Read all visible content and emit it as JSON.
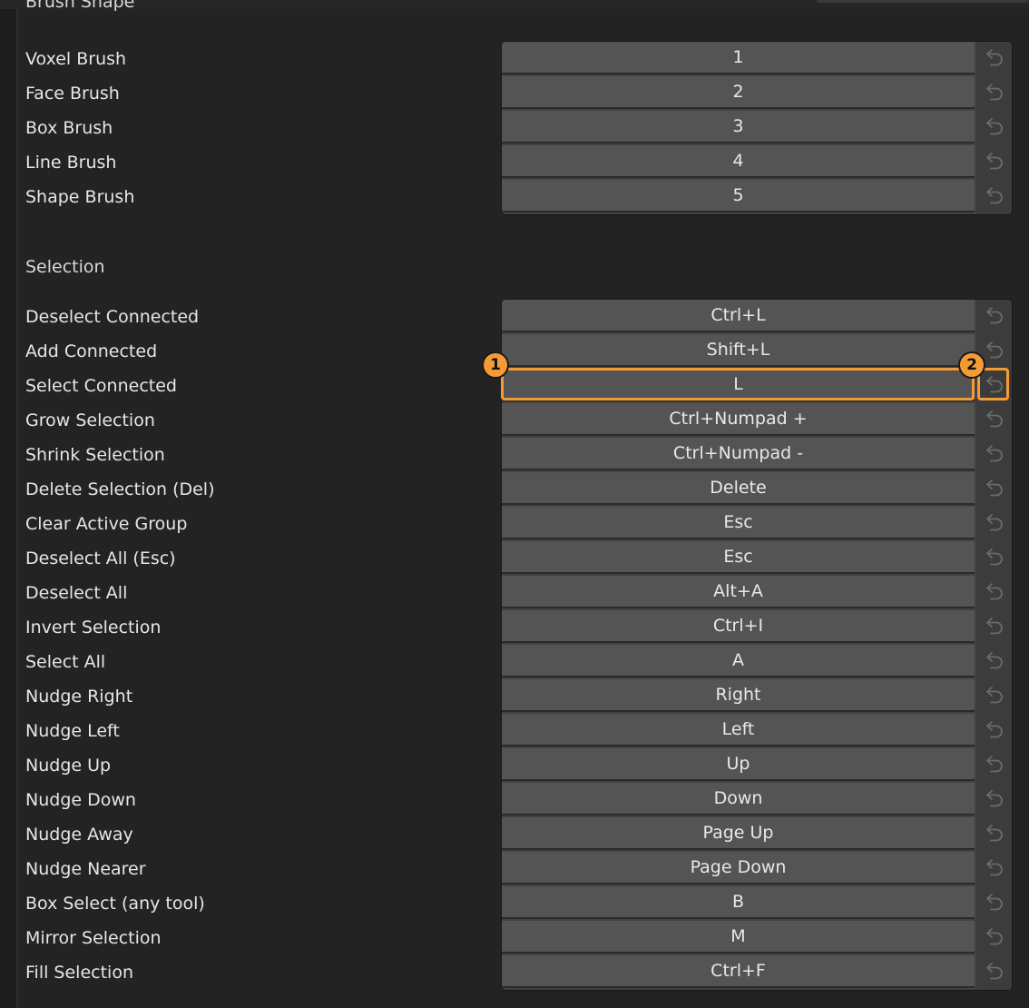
{
  "brush_shape": {
    "header": "Brush Shape",
    "rows": [
      {
        "label": "Voxel Brush",
        "key": "1"
      },
      {
        "label": "Face Brush",
        "key": "2"
      },
      {
        "label": "Box Brush",
        "key": "3"
      },
      {
        "label": "Line Brush",
        "key": "4"
      },
      {
        "label": "Shape Brush",
        "key": "5"
      }
    ]
  },
  "selection": {
    "header": "Selection",
    "rows": [
      {
        "label": "Deselect Connected",
        "key": "Ctrl+L"
      },
      {
        "label": "Add Connected",
        "key": "Shift+L"
      },
      {
        "label": "Select Connected",
        "key": "L"
      },
      {
        "label": "Grow Selection",
        "key": "Ctrl+Numpad +"
      },
      {
        "label": "Shrink Selection",
        "key": "Ctrl+Numpad -"
      },
      {
        "label": "Delete Selection (Del)",
        "key": "Delete"
      },
      {
        "label": "Clear Active Group",
        "key": "Esc"
      },
      {
        "label": "Deselect All (Esc)",
        "key": "Esc"
      },
      {
        "label": "Deselect All",
        "key": "Alt+A"
      },
      {
        "label": "Invert Selection",
        "key": "Ctrl+I"
      },
      {
        "label": "Select All",
        "key": "A"
      },
      {
        "label": "Nudge Right",
        "key": "Right"
      },
      {
        "label": "Nudge Left",
        "key": "Left"
      },
      {
        "label": "Nudge Up",
        "key": "Up"
      },
      {
        "label": "Nudge Down",
        "key": "Down"
      },
      {
        "label": "Nudge Away",
        "key": "Page Up"
      },
      {
        "label": "Nudge Nearer",
        "key": "Page Down"
      },
      {
        "label": "Box Select (any tool)",
        "key": "B"
      },
      {
        "label": "Mirror Selection",
        "key": "M"
      },
      {
        "label": "Fill Selection",
        "key": "Ctrl+F"
      }
    ]
  },
  "annotations": [
    {
      "number": "1",
      "target": "Select Connected key field"
    },
    {
      "number": "2",
      "target": "Select Connected reset button"
    }
  ],
  "icons": {
    "reset": "reset-arrow-icon"
  },
  "colors": {
    "highlight": "#f39c35",
    "background": "#232323",
    "field": "#545454"
  }
}
